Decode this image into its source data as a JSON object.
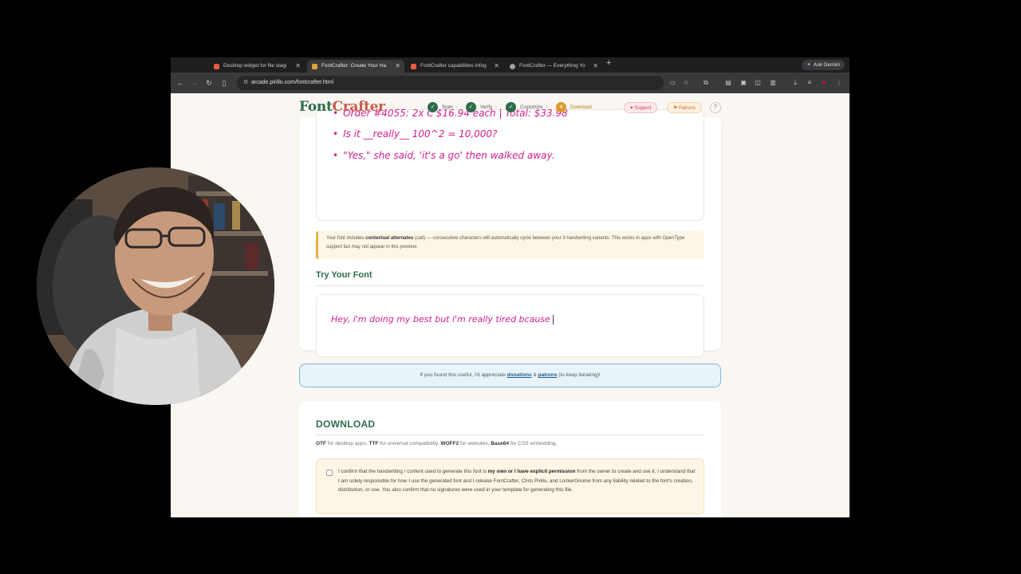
{
  "browser": {
    "tabs": [
      {
        "title": "Desktop widget for file stagi",
        "active": false,
        "favicon_color": "#e8593f"
      },
      {
        "title": "FontCrafter: Create Your Ha",
        "active": true,
        "favicon_color": "#e0a23a"
      },
      {
        "title": "FontCrafter capabilities infog",
        "active": false,
        "favicon_color": "#e8593f"
      },
      {
        "title": "FontCrafter — Everything Yo",
        "active": false,
        "favicon_color": "#9aa0a6"
      }
    ],
    "new_tab": "+",
    "gemini_label": "Ask Gemini",
    "url": "arcade.pirillo.com/fontcrafter.html"
  },
  "app": {
    "logo_part1": "Font",
    "logo_part2": "Crafter",
    "steps": [
      {
        "label": "Scan",
        "state": "done"
      },
      {
        "label": "Verify",
        "state": "done"
      },
      {
        "label": "Customize",
        "state": "done"
      },
      {
        "label": "Download",
        "state": "current",
        "number": "4"
      }
    ],
    "support_label": "Support",
    "patrons_label": "Patrons",
    "help_label": "?"
  },
  "preview": {
    "lines": [
      "Order #4055: 2x C'$16.94 each | Total: $33.98",
      "Is it __really__ 100^2 = 10,000?",
      "\"Yes,\" she said, 'it's a go' then walked away."
    ]
  },
  "notice": {
    "prefix": "Your font includes ",
    "bold": "contextual alternates",
    "suffix": " (calt) — consecutive characters will automatically cycle between your 3 handwriting variants. This works in apps with OpenType support but may not appear in this preview."
  },
  "try": {
    "title": "Try Your Font",
    "text": "Hey, i'm doing my best but i'm really tired bcause"
  },
  "donate": {
    "prefix": "If you found this useful, I'd appreciate ",
    "link1": "donations",
    "amp": " & ",
    "link2": "patrons",
    "suffix": " (to keep iterating)!"
  },
  "download": {
    "title": "DOWNLOAD",
    "otf": "OTF",
    "otf_desc": " for desktop apps, ",
    "ttf": "TTF",
    "ttf_desc": " for universal compatibility, ",
    "woff2": "WOFF2",
    "woff2_desc": " for websites, ",
    "base64": "Base64",
    "base64_desc": " for CSS embedding.",
    "confirm_prefix": "I confirm that the handwriting / content used to generate this font is ",
    "confirm_bold": "my own or I have explicit permission",
    "confirm_suffix": " from the owner to create and use it. I understand that I am solely responsible for how I use the generated font and I release FontCrafter, Chris Pirillo, and LockerGnome from any liability related to the font's creation, distribution, or use. You also confirm that no signatures were used in your template for generating this file.",
    "checked": false
  },
  "colors": {
    "brand_green": "#2e6b4c",
    "brand_red": "#c95a4a",
    "handwriting": "#d31e8c",
    "accent_amber": "#d99b2c"
  }
}
